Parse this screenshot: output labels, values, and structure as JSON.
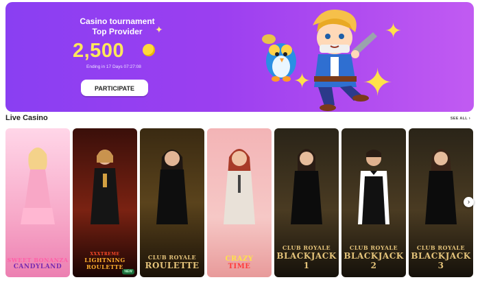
{
  "banner": {
    "title": "Casino tournament Top Provider",
    "amount": "2,500",
    "ending": "Ending in 17 Days  07:27:08",
    "cta": "PARTICIPATE"
  },
  "section": {
    "title": "Live Casino",
    "see_all": "SEE ALL"
  },
  "games": [
    {
      "logo_top": "SWEET BONANZA",
      "logo_main": "CANDYLAND",
      "accent": "#ff5fa8"
    },
    {
      "logo_top": "XXXTREME",
      "logo_main": "LIGHTNING ROULETTE",
      "accent": "#ffb02e",
      "badge": "NEW"
    },
    {
      "logo_top": "CLUB ROYALE",
      "logo_main": "ROULETTE",
      "accent": "#d8b25a"
    },
    {
      "logo_top": "CRAZY",
      "logo_main": "TIME",
      "accent": "#ff3b3b"
    },
    {
      "logo_top": "CLUB ROYALE",
      "logo_main": "BLACKJACK 1",
      "accent": "#d8b25a"
    },
    {
      "logo_top": "CLUB ROYALE",
      "logo_main": "BLACKJACK 2",
      "accent": "#d8b25a"
    },
    {
      "logo_top": "CLUB ROYALE",
      "logo_main": "BLACKJACK 3",
      "accent": "#d8b25a"
    }
  ],
  "icons": {
    "next": "chevron-right-icon",
    "coin": "coin-icon",
    "sparkle": "sparkle-icon"
  },
  "colors": {
    "banner_start": "#8a3ff2",
    "banner_end": "#c15bf2",
    "amount": "#ffe85a"
  }
}
